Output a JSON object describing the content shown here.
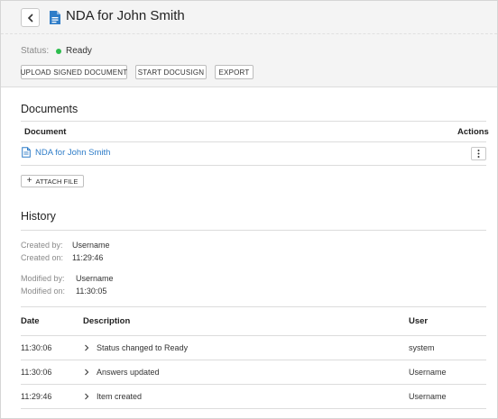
{
  "header": {
    "title": "NDA for John Smith",
    "status_label": "Status:",
    "status_value": "Ready",
    "status_color": "#2dbd4e",
    "buttons": {
      "upload": "UPLOAD SIGNED DOCUMENT",
      "docusign": "START DOCUSIGN",
      "export": "EXPORT"
    }
  },
  "documents": {
    "title": "Documents",
    "columns": {
      "document": "Document",
      "actions": "Actions"
    },
    "rows": [
      {
        "name": "NDA for John Smith"
      }
    ],
    "attach_label": "ATTACH FILE"
  },
  "history": {
    "title": "History",
    "created_by_label": "Created by:",
    "created_by_value": "Username",
    "created_on_label": "Created on:",
    "created_on_value": "11:29:46",
    "modified_by_label": "Modified by:",
    "modified_by_value": "Username",
    "modified_on_label": "Modified on:",
    "modified_on_value": "11:30:05",
    "columns": {
      "date": "Date",
      "description": "Description",
      "user": "User"
    },
    "rows": [
      {
        "date": "11:30:06",
        "description": "Status changed to Ready",
        "user": "system"
      },
      {
        "date": "11:30:06",
        "description": "Answers updated",
        "user": "Username"
      },
      {
        "date": "11:29:46",
        "description": "Item created",
        "user": "Username"
      }
    ]
  },
  "colors": {
    "link": "#2f7dc8",
    "accent_icon": "#2f7dc8"
  }
}
